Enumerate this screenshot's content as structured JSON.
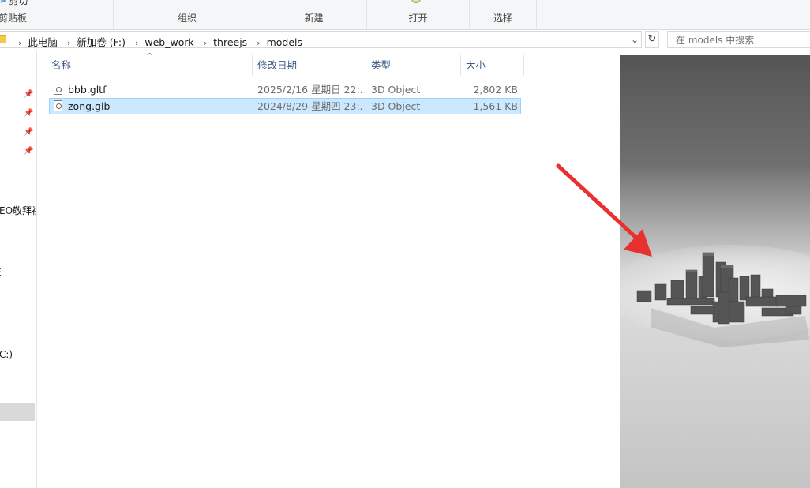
{
  "ribbon": {
    "clipboard_top": "剪切",
    "clipboard_label": "剪贴板",
    "organize_label": "组织",
    "new_label": "新建",
    "open_label": "打开",
    "select_label": "选择"
  },
  "address": {
    "crumbs": [
      "此电脑",
      "新加卷 (F:)",
      "web_work",
      "threejs",
      "models"
    ],
    "search_placeholder": "在 models 中搜索"
  },
  "nav": {
    "item_partial_1": "EO敬拜视",
    "item_partial_2": "E",
    "item_partial_3": "C:)"
  },
  "columns": {
    "name": "名称",
    "date": "修改日期",
    "type": "类型",
    "size": "大小"
  },
  "files": [
    {
      "name": "bbb.gltf",
      "date": "2025/2/16 星期日 22:...",
      "type": "3D Object",
      "size": "2,802 KB",
      "selected": false
    },
    {
      "name": "zong.glb",
      "date": "2024/8/29 星期四 23:...",
      "type": "3D Object",
      "size": "1,561 KB",
      "selected": true
    }
  ],
  "colors": {
    "selection_bg": "#cce8ff",
    "selection_border": "#99d1ff",
    "arrow": "#e8302f",
    "header_text": "#3d5a80"
  },
  "icons": {
    "folder": "folder-icon",
    "pin": "pin-icon",
    "file": "3d-object-file-icon",
    "refresh": "refresh-icon",
    "chevron": "chevron-right-icon"
  }
}
